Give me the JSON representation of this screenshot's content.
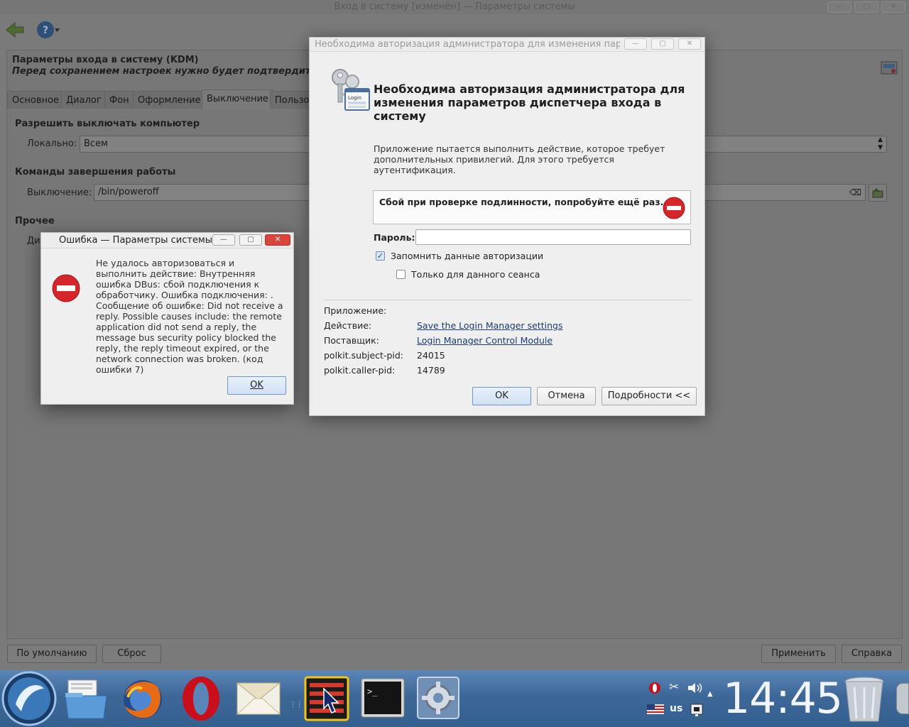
{
  "main": {
    "title": "Вход в систему [изменён] — Параметры системы",
    "header_title": "Параметры входа в систему (KDM)",
    "header_subtitle": "Перед сохранением настроек нужно будет подтвердить вход в",
    "tabs": [
      "Основное",
      "Диалог",
      "Фон",
      "Оформление",
      "Выключение",
      "Пользо"
    ],
    "shutdown_section": "Разрешить выключать компьютер",
    "local_label": "Локально:",
    "local_value": "Всем",
    "commands_section": "Команды завершения работы",
    "poweroff_label": "Выключение:",
    "poweroff_value": "/bin/poweroff",
    "other_section": "Прочее",
    "other_label_partial": "Ди",
    "default_button": "По умолчанию",
    "reset_button": "Сброс",
    "apply_button": "Применить",
    "help_button": "Справка"
  },
  "auth": {
    "title": "Необходима авторизация администратора для изменения параметр...",
    "heading": "Необходима авторизация администратора для изменения параметров диспетчера входа в систему",
    "message": "Приложение пытается выполнить действие, которое требует дополнительных привилегий. Для этого требуется аутентификация.",
    "error_text": "Сбой при проверке подлинности, попробуйте ещё раз.",
    "password_label": "Пароль:",
    "password_value": "",
    "remember_label": "Запомнить данные авторизации",
    "remember_checked": true,
    "session_label": "Только для данного сеанса",
    "session_checked": false,
    "details": {
      "app_label": "Приложение:",
      "action_label": "Действие:",
      "action_value": "Save the Login Manager settings",
      "vendor_label": "Поставщик:",
      "vendor_value": "Login Manager Control Module",
      "subject_pid_label": "polkit.subject-pid:",
      "subject_pid_value": "24015",
      "caller_pid_label": "polkit.caller-pid:",
      "caller_pid_value": "14789"
    },
    "ok_button": "OK",
    "cancel_button": "Отмена",
    "details_button": "Подробности <<",
    "login_card_label": "Login"
  },
  "error": {
    "title": "Ошибка — Параметры системы",
    "message": "Не удалось авторизоваться и выполнить действие: Внутренняя ошибка DBus: сбой подключения к обработчику. Ошибка подключения: . Сообщение об ошибке: Did not receive a reply. Possible causes include: the remote application did not send a reply, the message bus security policy blocked the reply, the reply timeout expired, or the network connection was broken. (код ошибки 7)",
    "ok_button": "OK"
  },
  "taskbar": {
    "clock": "14:45",
    "keyboard_layout": "us",
    "icons": [
      "menu-orb-icon",
      "file-manager-icon",
      "firefox-icon",
      "opera-icon",
      "mail-icon",
      "pointer-app-icon",
      "terminal-icon",
      "settings-icon",
      "trash-icon"
    ]
  },
  "colors": {
    "error_red": "#d6262b",
    "link": "#1c3a73",
    "taskbar": "#3d6797"
  }
}
